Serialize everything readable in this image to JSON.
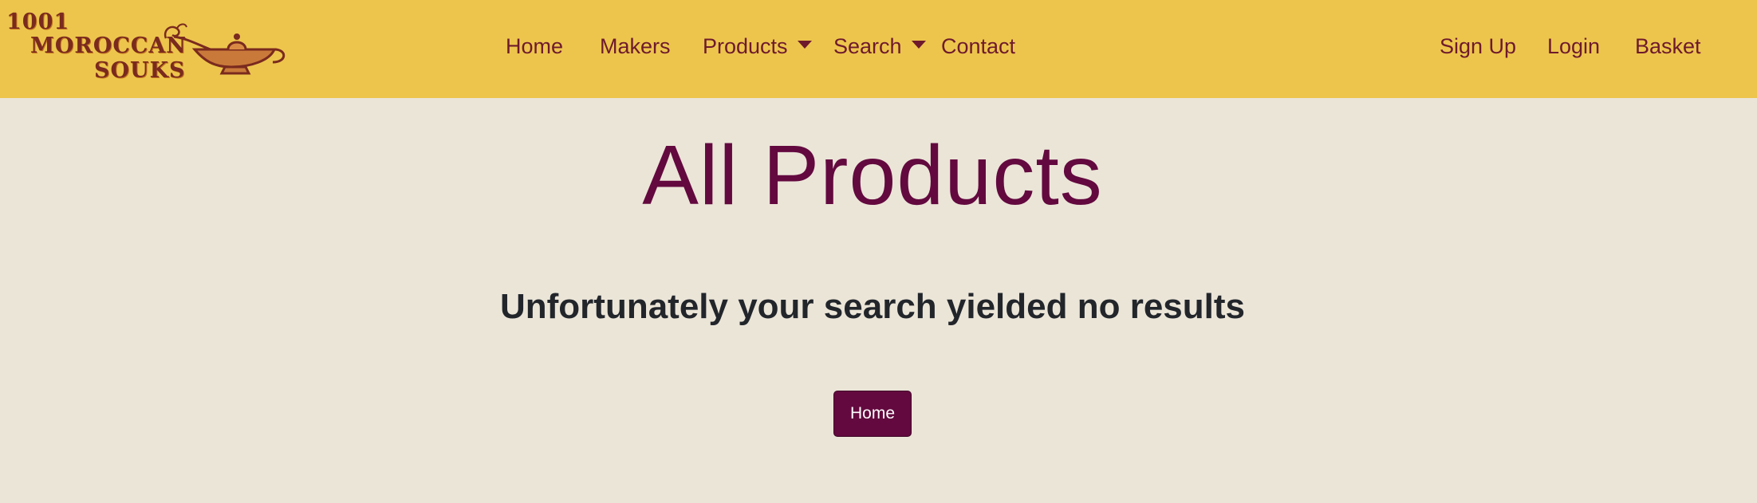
{
  "brand": {
    "line1": "1001",
    "line2": "MOROCCAN",
    "line3": "SOUKS",
    "logo_icon": "oil-lamp-icon"
  },
  "nav": {
    "home": "Home",
    "makers": "Makers",
    "products": "Products",
    "search": "Search",
    "contact": "Contact",
    "signup": "Sign Up",
    "login": "Login",
    "basket": "Basket"
  },
  "main": {
    "title": "All Products",
    "message": "Unfortunately your search yielded no results",
    "home_button": "Home"
  },
  "colors": {
    "navbar_bg": "#edc54d",
    "page_bg": "#ebe5d8",
    "accent": "#63093f",
    "nav_text": "#6e1a2c",
    "body_text": "#22262b"
  }
}
